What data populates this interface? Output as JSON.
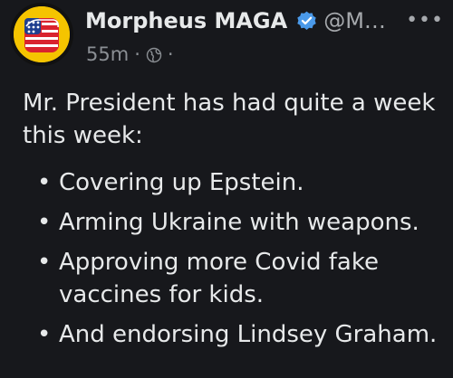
{
  "post": {
    "author_name": "Morpheus MAGA",
    "handle": "@M…",
    "timestamp": "55m",
    "separator": "·",
    "trailing_separator": "·",
    "more_label": "•••",
    "intro": "Mr. President has had quite a week this week:",
    "bullets": [
      "Covering up Epstein.",
      "Arming Ukraine with weapons.",
      "Approving more Covid fake vaccines for kids.",
      "And endorsing Lindsey Graham."
    ],
    "bullet_glyph": "•"
  },
  "icons": {
    "verified": "verified-badge-icon",
    "audience": "globe-icon",
    "more": "more-options-icon"
  },
  "colors": {
    "background": "#17181c",
    "text": "#e7e9ea",
    "secondary_text": "#8b8f94",
    "verified": "#4a99e9",
    "avatar_ring": "#f5c400"
  }
}
